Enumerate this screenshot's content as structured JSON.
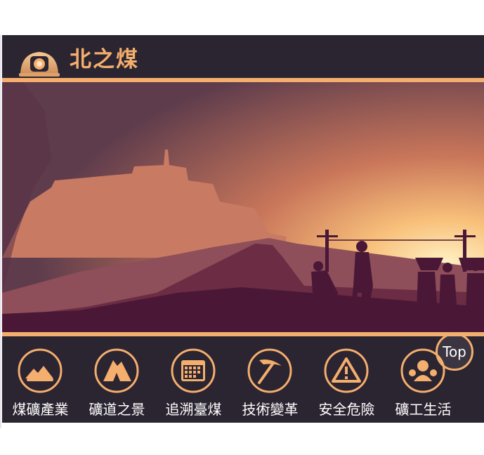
{
  "site": {
    "logo_text": "北之煤"
  },
  "nav": {
    "items": [
      {
        "label": "煤礦產業",
        "icon": "mine-landscape-icon"
      },
      {
        "label": "礦道之景",
        "icon": "mountain-icon"
      },
      {
        "label": "追溯臺煤",
        "icon": "calendar-icon"
      },
      {
        "label": "技術變革",
        "icon": "pickaxe-icon"
      },
      {
        "label": "安全危險",
        "icon": "warning-icon"
      },
      {
        "label": "礦工生活",
        "icon": "miners-icon"
      }
    ]
  },
  "top_button": {
    "label": "Top"
  },
  "colors": {
    "accent": "#f4ae6d",
    "frame_bg": "#2b2431",
    "icon_fill": "#f4ae6d",
    "icon_dark": "#2b2431"
  }
}
